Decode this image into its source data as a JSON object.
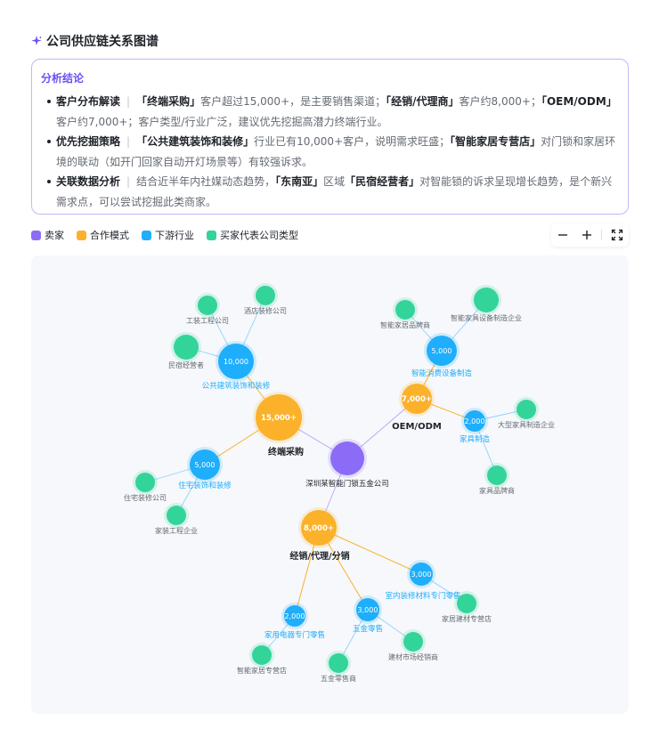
{
  "header": {
    "title": "公司供应链关系图谱",
    "spark_icon": "sparkle-icon"
  },
  "summary": {
    "title": "分析结论",
    "items": [
      {
        "heading": "客户分布解读",
        "segments": [
          {
            "t": "「终端采购」",
            "hl": true
          },
          {
            "t": "客户超过15,000+，是主要销售渠道；",
            "hl": false
          },
          {
            "t": "「经销/代理商」",
            "hl": true
          },
          {
            "t": "客户约8,000+；",
            "hl": false
          },
          {
            "t": "「OEM/ODM」",
            "hl": true
          },
          {
            "t": "客户约7,000+；客户类型/行业广泛，建议优先挖掘高潜力终端行业。",
            "hl": false
          }
        ]
      },
      {
        "heading": "优先挖掘策略",
        "segments": [
          {
            "t": "「公共建筑装饰和装修」",
            "hl": true
          },
          {
            "t": "行业已有10,000+客户，说明需求旺盛；",
            "hl": false
          },
          {
            "t": "「智能家居专营店」",
            "hl": true
          },
          {
            "t": "对门锁和家居环境的联动（如开门回家自动开灯场景等）有较强诉求。",
            "hl": false
          }
        ]
      },
      {
        "heading": "关联数据分析",
        "segments": [
          {
            "t": "结合近半年内社媒动态趋势，",
            "hl": false
          },
          {
            "t": "「东南亚」",
            "hl": true
          },
          {
            "t": "区域",
            "hl": false
          },
          {
            "t": "「民宿经营者」",
            "hl": true
          },
          {
            "t": "对智能锁的诉求呈现增长趋势，是个新兴需求点，可以尝试挖掘此类商家。",
            "hl": false
          }
        ]
      }
    ]
  },
  "legend": [
    {
      "label": "卖家",
      "color": "#8b6cf6"
    },
    {
      "label": "合作模式",
      "color": "#fbb12a"
    },
    {
      "label": "下游行业",
      "color": "#1eaefb"
    },
    {
      "label": "买家代表公司类型",
      "color": "#33d49a"
    }
  ],
  "toolbar": {
    "zoom_out": "zoom-out-icon",
    "zoom_in": "zoom-in-icon",
    "fullscreen": "fullscreen-icon"
  },
  "graph": {
    "nodes": [
      {
        "id": "seller",
        "type": "seller",
        "value": "",
        "label": "深圳某智能门锁五金公司"
      },
      {
        "id": "terminal",
        "type": "mode",
        "value": "15,000+",
        "label": "终端采购"
      },
      {
        "id": "oem",
        "type": "mode",
        "value": "7,000+",
        "label": "OEM/ODM"
      },
      {
        "id": "dist",
        "type": "mode",
        "value": "8,000+",
        "label": "经销/代理/分销"
      },
      {
        "id": "public",
        "type": "industry",
        "value": "10,000",
        "label": "公共建筑装饰和装修"
      },
      {
        "id": "home",
        "type": "industry",
        "value": "5,000",
        "label": "住宅装饰和装修"
      },
      {
        "id": "smartmfg",
        "type": "industry",
        "value": "5,000",
        "label": "智能消费设备制造"
      },
      {
        "id": "furn",
        "type": "industry",
        "value": "2,000",
        "label": "家具制造"
      },
      {
        "id": "indoor",
        "type": "industry",
        "value": "3,000",
        "label": "室内装修材料专门零售"
      },
      {
        "id": "hardware",
        "type": "industry",
        "value": "3,000",
        "label": "五金零售"
      },
      {
        "id": "appliance",
        "type": "industry",
        "value": "2,000",
        "label": "家用电器专门零售"
      },
      {
        "id": "b1",
        "type": "buyer",
        "value": "",
        "label": "工装工程公司"
      },
      {
        "id": "b2",
        "type": "buyer",
        "value": "",
        "label": "酒店装修公司"
      },
      {
        "id": "b3",
        "type": "buyer",
        "value": "",
        "label": "民宿经营者"
      },
      {
        "id": "b4",
        "type": "buyer",
        "value": "",
        "label": "住宅装修公司"
      },
      {
        "id": "b5",
        "type": "buyer",
        "value": "",
        "label": "家装工程企业"
      },
      {
        "id": "b6",
        "type": "buyer",
        "value": "",
        "label": "智能家居品牌商"
      },
      {
        "id": "b7",
        "type": "buyer",
        "value": "",
        "label": "智能家具设备制造企业"
      },
      {
        "id": "b8",
        "type": "buyer",
        "value": "",
        "label": "大型家具制造企业"
      },
      {
        "id": "b9",
        "type": "buyer",
        "value": "",
        "label": "家具品牌商"
      },
      {
        "id": "b10",
        "type": "buyer",
        "value": "",
        "label": "家居建材专营店"
      },
      {
        "id": "b11",
        "type": "buyer",
        "value": "",
        "label": "建材市场经销商"
      },
      {
        "id": "b12",
        "type": "buyer",
        "value": "",
        "label": "五金零售商"
      },
      {
        "id": "b13",
        "type": "buyer",
        "value": "",
        "label": "智能家居专营店"
      }
    ],
    "edges": [
      [
        "seller",
        "terminal"
      ],
      [
        "seller",
        "oem"
      ],
      [
        "seller",
        "dist"
      ],
      [
        "terminal",
        "public"
      ],
      [
        "terminal",
        "home"
      ],
      [
        "oem",
        "smartmfg"
      ],
      [
        "oem",
        "furn"
      ],
      [
        "dist",
        "indoor"
      ],
      [
        "dist",
        "hardware"
      ],
      [
        "dist",
        "appliance"
      ],
      [
        "public",
        "b1"
      ],
      [
        "public",
        "b2"
      ],
      [
        "public",
        "b3"
      ],
      [
        "home",
        "b4"
      ],
      [
        "home",
        "b5"
      ],
      [
        "smartmfg",
        "b6"
      ],
      [
        "smartmfg",
        "b7"
      ],
      [
        "furn",
        "b8"
      ],
      [
        "furn",
        "b9"
      ],
      [
        "indoor",
        "b10"
      ],
      [
        "hardware",
        "b11"
      ],
      [
        "hardware",
        "b12"
      ],
      [
        "appliance",
        "b13"
      ]
    ],
    "colors": {
      "seller": "#8b6cf6",
      "mode": "#fbb12a",
      "industry": "#1eaefb",
      "buyer": "#33d49a"
    }
  }
}
